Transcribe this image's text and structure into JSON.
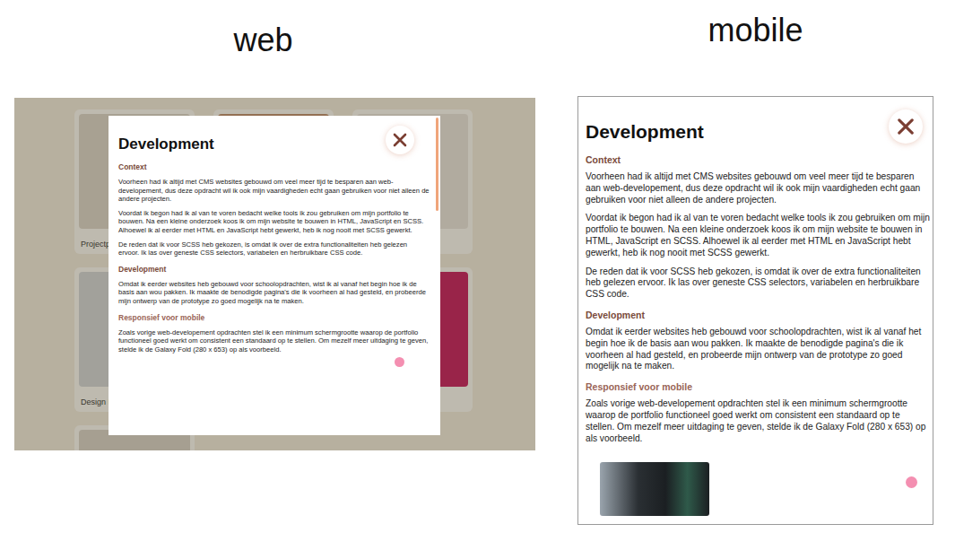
{
  "labels": {
    "web": "web",
    "mobile": "mobile"
  },
  "background_cards": [
    {
      "caption": "Projectp",
      "color": "#d9d3c8"
    },
    {
      "caption": "",
      "color": "#b98a6a"
    },
    {
      "caption": "",
      "color": "#e6e2dc"
    },
    {
      "caption": "Design I",
      "color": "#cfd3d6"
    },
    {
      "caption": "",
      "color": "#d8cfc2"
    },
    {
      "caption": "",
      "color": "#c2185b"
    },
    {
      "caption": "",
      "color": "#d6d0c6"
    }
  ],
  "article": {
    "title": "Development",
    "sections": [
      {
        "heading": "Context",
        "kind": "section",
        "paragraphs": [
          "Voorheen had ik altijd met CMS websites gebouwd om veel meer tijd te besparen aan web-developement, dus deze opdracht wil ik ook mijn vaardigheden echt gaan gebruiken voor niet alleen de andere projecten.",
          "Voordat ik begon had ik al van te voren bedacht welke tools ik zou gebruiken om mijn portfolio te bouwen. Na een kleine onderzoek koos ik om mijn website te bouwen in HTML, JavaScript en SCSS. Alhoewel ik al eerder met HTML en JavaScript hebt gewerkt, heb ik nog nooit met SCSS gewerkt.",
          "De reden dat ik voor SCSS heb gekozen, is omdat ik over de extra functionaliteiten heb gelezen ervoor. Ik las over geneste CSS selectors, variabelen en herbruikbare CSS code."
        ]
      },
      {
        "heading": "Development",
        "kind": "section",
        "paragraphs": [
          "Omdat ik eerder websites heb gebouwd voor schoolopdrachten, wist ik al vanaf het begin hoe ik de basis aan wou pakken. Ik maakte de benodigde pagina's die ik voorheen al had gesteld, en probeerde mijn ontwerp van de prototype zo goed mogelijk na te maken."
        ]
      },
      {
        "heading": "Responsief voor mobile",
        "kind": "subsection",
        "paragraphs": [
          "Zoals vorige web-developement opdrachten stel ik een minimum schermgrootte waarop de portfolio functioneel goed werkt om consistent een standaard op te stellen. Om mezelf meer uitdaging te geven, stelde ik de Galaxy Fold (280 x 653) op als voorbeeld."
        ]
      }
    ]
  }
}
